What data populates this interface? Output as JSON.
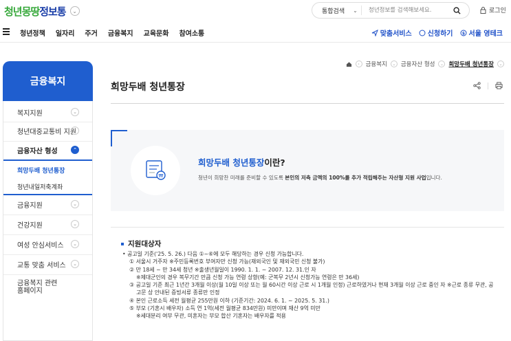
{
  "header": {
    "logo": {
      "part1": "청년몽땅",
      "part2": "정보통"
    },
    "search": {
      "type_label": "통합검색",
      "placeholder": "청년정보를 검색해보세요."
    },
    "login_label": "로그인"
  },
  "gnb": {
    "items": [
      "청년정책",
      "일자리",
      "주거",
      "금융복지",
      "교육문화",
      "참여소통"
    ],
    "right": [
      "맞춤서비스",
      "신청하기",
      "서울 영테크"
    ]
  },
  "sidebar": {
    "title": "금융복지",
    "items": [
      {
        "label": "복지지원"
      },
      {
        "label": "청년대중교통비 지원"
      },
      {
        "label": "금융자산 형성"
      },
      {
        "label": "금융지원"
      },
      {
        "label": "건강지원"
      },
      {
        "label": "여성 안심서비스"
      },
      {
        "label": "교통 맞춤 서비스"
      },
      {
        "label": "금융복지 관련\n홈페이지"
      }
    ],
    "subitems": [
      "희망두배 청년통장",
      "청년내일저축계좌"
    ]
  },
  "breadcrumb": [
    "금융복지",
    "금융자산 형성",
    "희망두배 청년통장"
  ],
  "page_title": "희망두배 청년통장",
  "intro": {
    "title_highlight": "희망두배 청년통장",
    "title_rest": "이란?",
    "desc_pre": "청년이 희망찬 미래를 준비할 수 있도록 ",
    "desc_bold": "본인의 저축 금액의 100%를 추가 적립해주는 자산형 지원 사업",
    "desc_post": "입니다."
  },
  "section": {
    "title": "지원대상자",
    "lines": [
      "• 공고일 기준('25. 5. 26.) 다음 ①~⑥에 모두 해당하는 경우 신청 가능합니다.",
      "① 서울시 거주자 ※주민등록번호 부여자만 신청 가능(재외국인 및 재외국민 신청 불가)",
      "② 만 18세 ~ 만 34세 청년 ※출생년월일이 1990. 1. 1. ~ 2007. 12. 31.인 자",
      "※제대군인의 경우 복무기간 만큼 신청 가능 연령 상향(예: 군복무 2년시 신청가능 연령은 만 36세)",
      "③ 공고일 기준 최근 1년간 3개월 이상(월 10일 이상 또는 월 60시간 이상 근로 시 1개월 인정) 근로하였거나 현재 3개월 이상 근로 중인 자 ※근로 종류 무관, 공",
      "고문 상 안내된 증빙서류 종류만 인정",
      "④ 본인 근로소득 세전 월평균 255만원 이하 (기준기간: 2024. 6. 1. ~ 2025. 5. 31.)",
      "⑤ 부모 (기혼시 배우자) 소득 연 1억(세전 월평균 834만원) 미만이며 재산 9억 미만",
      "※세대분리 여부 무관, 미혼자는 부모 합산 기혼자는 배우자를 적용"
    ]
  },
  "colors": {
    "accent": "#1f5ecf",
    "logo_green": "#36a83a"
  }
}
